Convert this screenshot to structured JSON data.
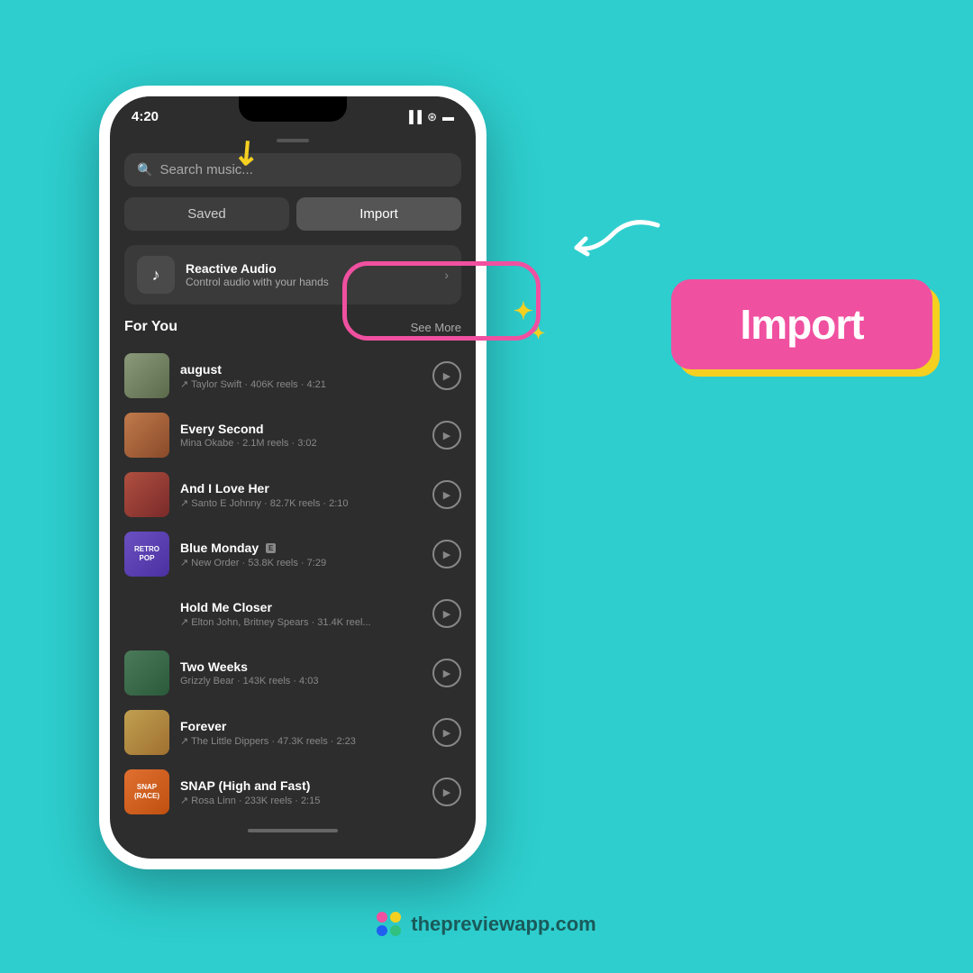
{
  "background_color": "#2ecece",
  "status_bar": {
    "time": "4:20",
    "icons": "▐▐ ⓦ ▬"
  },
  "search": {
    "placeholder": "Search music..."
  },
  "tabs": {
    "saved_label": "Saved",
    "import_label": "Import"
  },
  "reactive_audio": {
    "title": "Reactive Audio",
    "subtitle": "Control audio with your hands"
  },
  "for_you": {
    "section_title": "For You",
    "see_more_label": "See More"
  },
  "music_items": [
    {
      "title": "august",
      "meta": "↗ Taylor Swift · 406K reels · 4:21",
      "thumb_class": "thumb-august",
      "explicit": false
    },
    {
      "title": "Every Second",
      "meta": "Mina Okabe · 2.1M reels · 3:02",
      "thumb_class": "thumb-everysecond",
      "explicit": false
    },
    {
      "title": "And I Love Her",
      "meta": "↗ Santo E Johnny · 82.7K reels · 2:10",
      "thumb_class": "thumb-andilovher",
      "explicit": false
    },
    {
      "title": "Blue Monday",
      "meta": "↗ New Order · 53.8K reels · 7:29",
      "thumb_class": "thumb-bluemonday",
      "explicit": true
    },
    {
      "title": "Hold Me Closer",
      "meta": "↗ Elton John, Britney Spears · 31.4K reel...",
      "thumb_class": "thumb-holdmecloser",
      "explicit": false
    },
    {
      "title": "Two Weeks",
      "meta": "Grizzly Bear · 143K reels · 4:03",
      "thumb_class": "thumb-twoweeks",
      "explicit": false
    },
    {
      "title": "Forever",
      "meta": "↗ The Little Dippers · 47.3K reels · 2:23",
      "thumb_class": "thumb-forever",
      "explicit": false
    },
    {
      "title": "SNAP (High and Fast)",
      "meta": "↗ Rosa Linn · 233K reels · 2:15",
      "thumb_class": "thumb-snap",
      "explicit": false
    }
  ],
  "import_card": {
    "label": "Import"
  },
  "footer": {
    "url": "thepreviewapp.com"
  },
  "arrow_symbol": "←",
  "squiggle_top": "↙",
  "squiggle_right": "✦"
}
